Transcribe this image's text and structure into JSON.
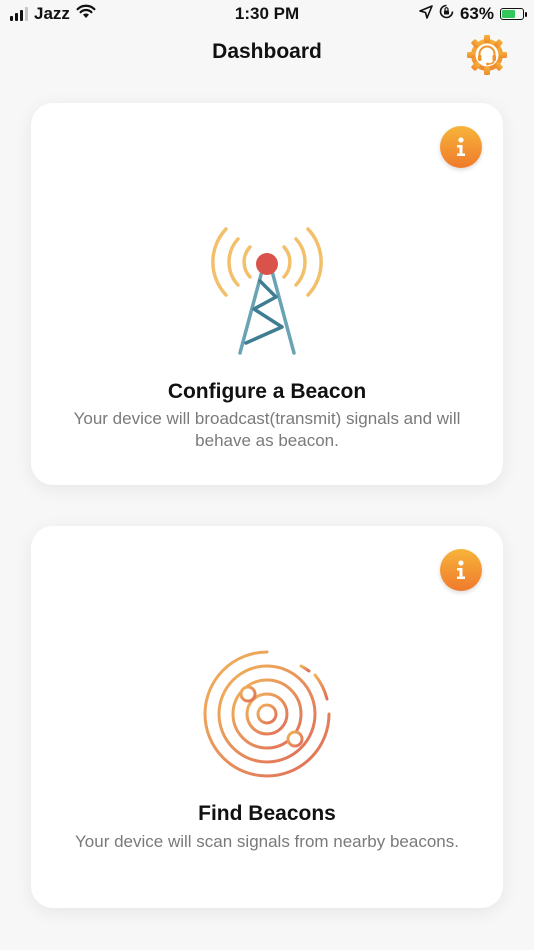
{
  "status_bar": {
    "carrier": "Jazz",
    "time": "1:30 PM",
    "battery_percent": "63%",
    "battery_level": 0.63,
    "icons": [
      "signal-icon",
      "wifi-icon",
      "location-arrow-icon",
      "rotation-lock-icon",
      "battery-charging-icon"
    ]
  },
  "header": {
    "title": "Dashboard",
    "support_icon": "headset-gear-icon"
  },
  "cards": [
    {
      "title": "Configure a Beacon",
      "description": "Your device will broadcast(transmit) signals and will behave as beacon.",
      "icon": "broadcast-tower-icon",
      "info_icon": "info-icon"
    },
    {
      "title": "Find Beacons",
      "description": "Your device will scan signals from nearby beacons.",
      "icon": "radar-icon",
      "info_icon": "info-icon"
    }
  ],
  "colors": {
    "accent_orange": "#f39a33",
    "tower_red": "#d9534a",
    "tower_teal": "#5f9fae",
    "wave_yellow": "#f2c06a"
  }
}
